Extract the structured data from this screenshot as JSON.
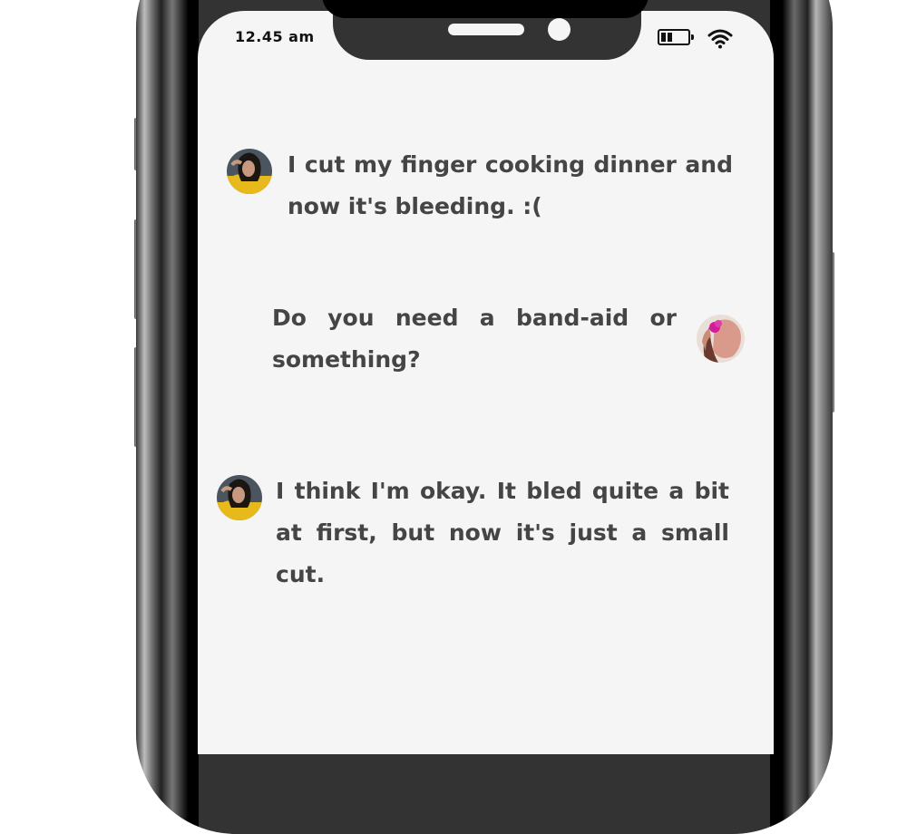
{
  "status_bar": {
    "time": "12.45 am",
    "battery_level": 0.4,
    "battery_icon": "battery-icon",
    "wifi_icon": "wifi-icon"
  },
  "chat": {
    "messages": [
      {
        "sender": "friend",
        "side": "left",
        "avatar": "avatar-woman-yellow-top",
        "text": "I cut my finger cooking dinner and now it's bleeding. :("
      },
      {
        "sender": "user",
        "side": "right",
        "avatar": "avatar-woman-pink-flower",
        "text": "Do you need a band-aid or something?"
      },
      {
        "sender": "friend",
        "side": "left",
        "avatar": "avatar-woman-yellow-top",
        "text": "I think I'm okay. It bled quite a bit at first, but now it's just a small cut."
      }
    ]
  },
  "colors": {
    "screen_bg": "#f5f5f5",
    "text": "#454545",
    "bezel": "#333333"
  }
}
